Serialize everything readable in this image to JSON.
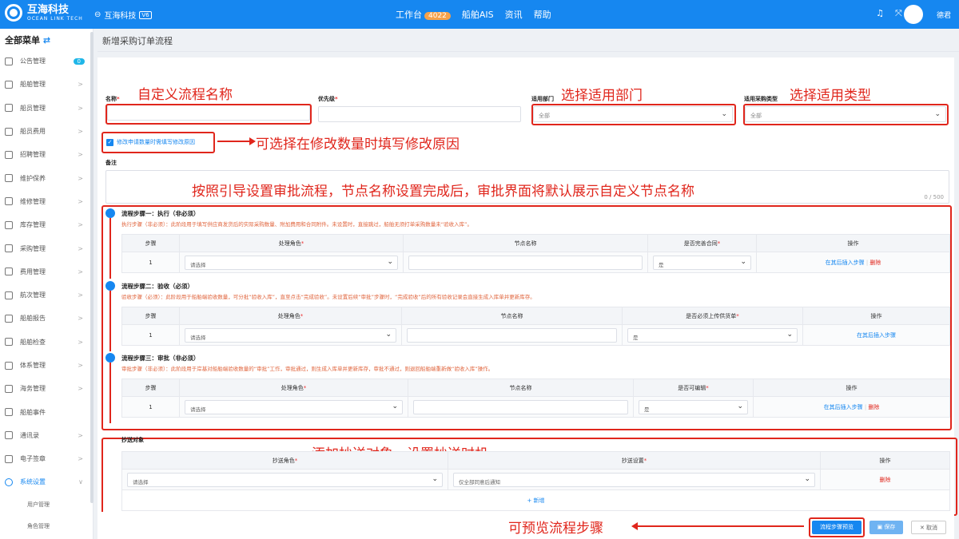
{
  "topbar": {
    "logo_title": "互海科技",
    "logo_subtitle": "OCEAN LINK TECH",
    "home_label": "互海科技",
    "home_version": "V6",
    "nav": [
      {
        "label": "工作台",
        "badge": "4022"
      },
      {
        "label": "船舶AIS"
      },
      {
        "label": "资讯"
      },
      {
        "label": "帮助"
      }
    ],
    "user_name": "德君"
  },
  "sidebar": {
    "header": "全部菜单",
    "items": [
      {
        "label": "公告管理",
        "count": "0"
      },
      {
        "label": "船舶管理",
        "chevron": ">"
      },
      {
        "label": "船员管理",
        "chevron": ">"
      },
      {
        "label": "船员费用",
        "chevron": ">"
      },
      {
        "label": "招聘管理",
        "chevron": ">"
      },
      {
        "label": "维护保养",
        "chevron": ">"
      },
      {
        "label": "维修管理",
        "chevron": ">"
      },
      {
        "label": "库存管理",
        "chevron": ">"
      },
      {
        "label": "采购管理",
        "chevron": ">"
      },
      {
        "label": "费用管理",
        "chevron": ">"
      },
      {
        "label": "航次管理",
        "chevron": ">"
      },
      {
        "label": "船舶报告",
        "chevron": ">"
      },
      {
        "label": "船舶检查",
        "chevron": ">"
      },
      {
        "label": "体系管理",
        "chevron": ">"
      },
      {
        "label": "海务管理",
        "chevron": ">"
      },
      {
        "label": "船舶事件",
        "chevron": ""
      },
      {
        "label": "通讯录",
        "chevron": ">"
      },
      {
        "label": "电子签章",
        "chevron": ">"
      },
      {
        "label": "系统设置",
        "chevron": "∨",
        "active": true
      }
    ],
    "subitems": [
      "用户管理",
      "角色管理"
    ]
  },
  "page": {
    "title": "新增采购订单流程"
  },
  "form": {
    "name_label": "名称",
    "priority_label": "优先级",
    "dept_label": "适用部门",
    "dept_value": "全部",
    "type_label": "适用采购类型",
    "type_value": "全部",
    "checkbox_label": "修改申请数量时需填写修改原因",
    "remark_label": "备注",
    "remark_counter": "0 / 500"
  },
  "annotations": {
    "name": "自定义流程名称",
    "dept": "选择适用部门",
    "type": "选择适用类型",
    "checkbox": "可选择在修改数量时填写修改原因",
    "flow": "按照引导设置审批流程，节点名称设置完成后，审批界面将默认展示自定义节点名称",
    "cc": "添加抄送对象，设置抄送时机",
    "preview": "可预览流程步骤"
  },
  "steps": [
    {
      "title": "流程步骤一：执行（非必须）",
      "desc": "执行步骤（非必须）：此阶段用于填写供应商发货后的实际采购数量、附加费用和合同附件。未设置时，直接跳过，船舶无须打单采购数量未“验收入库”。",
      "headers": [
        "步骤",
        "处理角色",
        "节点名称",
        "是否完善合同",
        "操作"
      ],
      "required": [
        false,
        true,
        false,
        true,
        false
      ],
      "row": {
        "step": "1",
        "role": "请选择",
        "flag": "是",
        "insert": "在其后插入步骤",
        "delete": "删除"
      }
    },
    {
      "title": "流程步骤二：验收（必须）",
      "desc": "验收步骤（必须）：此阶段用于船舶端验收数量，可分批“验收入库”，直至点击“完成验收”。未设置后续“审批”步骤时，“完成验收”后的所有验收记录会直接生成入库单并更新库存。",
      "headers": [
        "步骤",
        "处理角色",
        "节点名称",
        "是否必须上传供货单",
        "操作"
      ],
      "required": [
        false,
        true,
        false,
        true,
        false
      ],
      "row": {
        "step": "1",
        "role": "请选择",
        "flag": "是",
        "insert": "在其后插入步骤",
        "delete": ""
      }
    },
    {
      "title": "流程步骤三：审批（非必须）",
      "desc": "审批步骤（非必须）：此阶段用于岸基对船舶端验收数量的“审批”工作，审批通过，则生成入库单并更新库存，审批不通过，则退回船舶端重新做“验收入库”操作。",
      "headers": [
        "步骤",
        "处理角色",
        "节点名称",
        "是否可编辑",
        "操作"
      ],
      "required": [
        false,
        true,
        false,
        true,
        false
      ],
      "row": {
        "step": "1",
        "role": "请选择",
        "flag": "是",
        "insert": "在其后插入步骤",
        "delete": "删除"
      }
    }
  ],
  "cc": {
    "title": "抄送对象",
    "headers": [
      "抄送角色",
      "抄送设置",
      "操作"
    ],
    "row": {
      "role": "请选择",
      "setting": "仅全部同意后通知",
      "delete": "删除"
    },
    "add": "+ 新增"
  },
  "bottom": {
    "preview": "流程步骤预览",
    "save": "保存",
    "cancel": "取消"
  }
}
